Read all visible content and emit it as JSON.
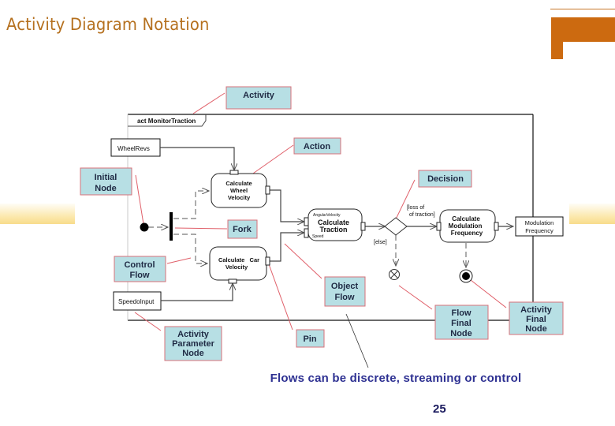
{
  "slide": {
    "title": "Activity Diagram Notation",
    "note": "Flows can be discrete, streaming or control",
    "page_number": "25"
  },
  "colors": {
    "title": "#b5701e",
    "accent": "#cc6a10",
    "callout_fill": "#b7dfe4",
    "callout_border": "#d7707a",
    "leader_line": "#e0606a",
    "note_text": "#2e3192"
  },
  "diagram": {
    "frame_label": "act MonitorTraction",
    "parameter_nodes": {
      "wheel_revs": "WheelRevs",
      "speedo_input": "SpeedoInput",
      "modulation_frequency": [
        "Modulation",
        "Frequency"
      ]
    },
    "actions": {
      "wheel_velocity": [
        "Calculate",
        "Wheel",
        "Velocity"
      ],
      "car_velocity": [
        "Calculate   Car",
        "Velocity"
      ],
      "traction": [
        "Calculate",
        "Traction"
      ],
      "modulation": [
        "Calculate",
        "Modulation",
        "Frequency"
      ]
    },
    "pin_labels": {
      "angular_velocity": "AngularVelocity",
      "speed": "Speed"
    },
    "guards": {
      "loss": [
        "[loss of",
        "of traction]"
      ],
      "else": "[else]"
    }
  },
  "callouts": {
    "activity": [
      "Activity"
    ],
    "action": [
      "Action"
    ],
    "initial_node": [
      "Initial",
      "Node"
    ],
    "decision": [
      "Decision"
    ],
    "fork": [
      "Fork"
    ],
    "control_flow": [
      "Control",
      "Flow"
    ],
    "object_flow": [
      "Object",
      "Flow"
    ],
    "flow_final_node": [
      "Flow",
      "Final",
      "Node"
    ],
    "activity_final_node": [
      "Activity",
      "Final",
      "Node"
    ],
    "activity_parameter_node": [
      "Activity",
      "Parameter",
      "Node"
    ],
    "pin": [
      "Pin"
    ]
  }
}
